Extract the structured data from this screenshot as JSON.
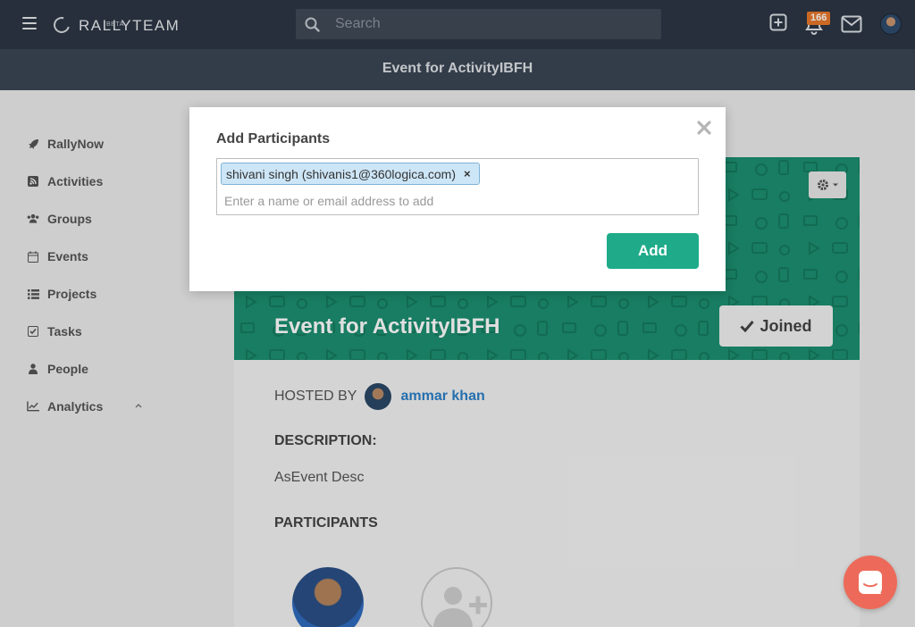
{
  "app": {
    "logo_text": "RALLYTEAM",
    "logo_badge": "BETA"
  },
  "topbar": {
    "search_placeholder": "Search",
    "notification_count": "166",
    "icons": [
      "menu-icon",
      "plus-square-icon",
      "bell-icon",
      "mail-icon",
      "user-avatar"
    ]
  },
  "subheader": {
    "title": "Event for ActivityIBFH"
  },
  "sidebar": {
    "items": [
      {
        "label": "RallyNow",
        "icon": "rocket-icon"
      },
      {
        "label": "Activities",
        "icon": "rss-icon"
      },
      {
        "label": "Groups",
        "icon": "users-icon"
      },
      {
        "label": "Events",
        "icon": "calendar-icon"
      },
      {
        "label": "Projects",
        "icon": "list-icon"
      },
      {
        "label": "Tasks",
        "icon": "check-square-icon"
      },
      {
        "label": "People",
        "icon": "user-icon"
      },
      {
        "label": "Analytics",
        "icon": "line-chart-icon"
      }
    ]
  },
  "event": {
    "title": "Event for ActivityIBFH",
    "joined_label": "Joined",
    "hosted_by_label": "HOSTED BY",
    "host_name": "ammar khan",
    "description_heading": "DESCRIPTION:",
    "description_text": "AsEvent Desc",
    "participants_heading": "PARTICIPANTS"
  },
  "modal": {
    "title": "Add Participants",
    "selected_tags": [
      "shivani singh (shivanis1@360logica.com)"
    ],
    "tag_remove_symbol": "×",
    "input_placeholder": "Enter a name or email address to add",
    "add_button": "Add"
  },
  "colors": {
    "topbar": "#2c3644",
    "subbar": "#3b4654",
    "banner": "#1c8f70",
    "primary_button": "#1fab89",
    "badge": "#e8772a",
    "link": "#2a7fc7",
    "chat": "#ed6a5a"
  }
}
